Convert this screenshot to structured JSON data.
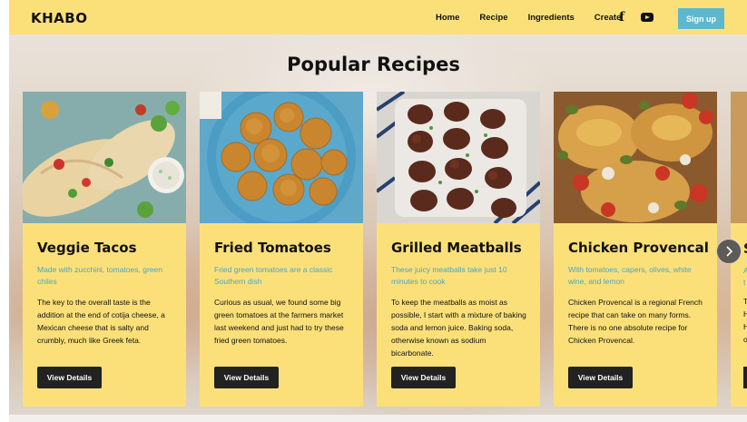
{
  "navbar": {
    "logo": "KHABO",
    "links": [
      "Home",
      "Recipe",
      "Ingredients",
      "Create"
    ],
    "social_icons": [
      "facebook-icon",
      "youtube-icon"
    ],
    "signup_label": "Sign up"
  },
  "heading": "Popular Recipes",
  "cards": [
    {
      "title": "Veggie Tacos",
      "subtitle": "Made with zucchini, tomatoes, green chiles",
      "description": "The key to the overall taste is the addition at the end of cotija cheese, a Mexican cheese that is salty and crumbly, much like Greek feta.",
      "button": "View Details"
    },
    {
      "title": "Fried Tomatoes",
      "subtitle": "Fried green tomatoes are a classic Southern dish",
      "description": "Curious as usual, we found some big green tomatoes at the farmers market last weekend and just had to try these fried green tomatoes.",
      "button": "View Details"
    },
    {
      "title": "Grilled Meatballs",
      "subtitle": "These juicy meatballs take just 10 minutes to cook",
      "description": "To keep the meatballs as moist as possible, I start with a mixture of baking soda and lemon juice. Baking soda, otherwise known as sodium bicarbonate.",
      "button": "View Details"
    },
    {
      "title": "Chicken Provencal",
      "subtitle": "With tomatoes, capers, olives, white wine, and lemon",
      "description": "Chicken Provencal is a regional French recipe that can take on many forms. There is no one absolute recipe for Chicken Provencal.",
      "button": "View Details"
    }
  ],
  "partial_card": {
    "title_fragment": "S",
    "subtitle_fragment": "A",
    "subtitle_fragment_2": "t",
    "desc_fragments": [
      "T",
      "H",
      "H",
      "o"
    ]
  },
  "colors": {
    "accent_yellow": "#fbe07a",
    "signup_blue": "#5db8cf",
    "subtitle_blue": "#4aa6c4",
    "button_dark": "#222222"
  }
}
